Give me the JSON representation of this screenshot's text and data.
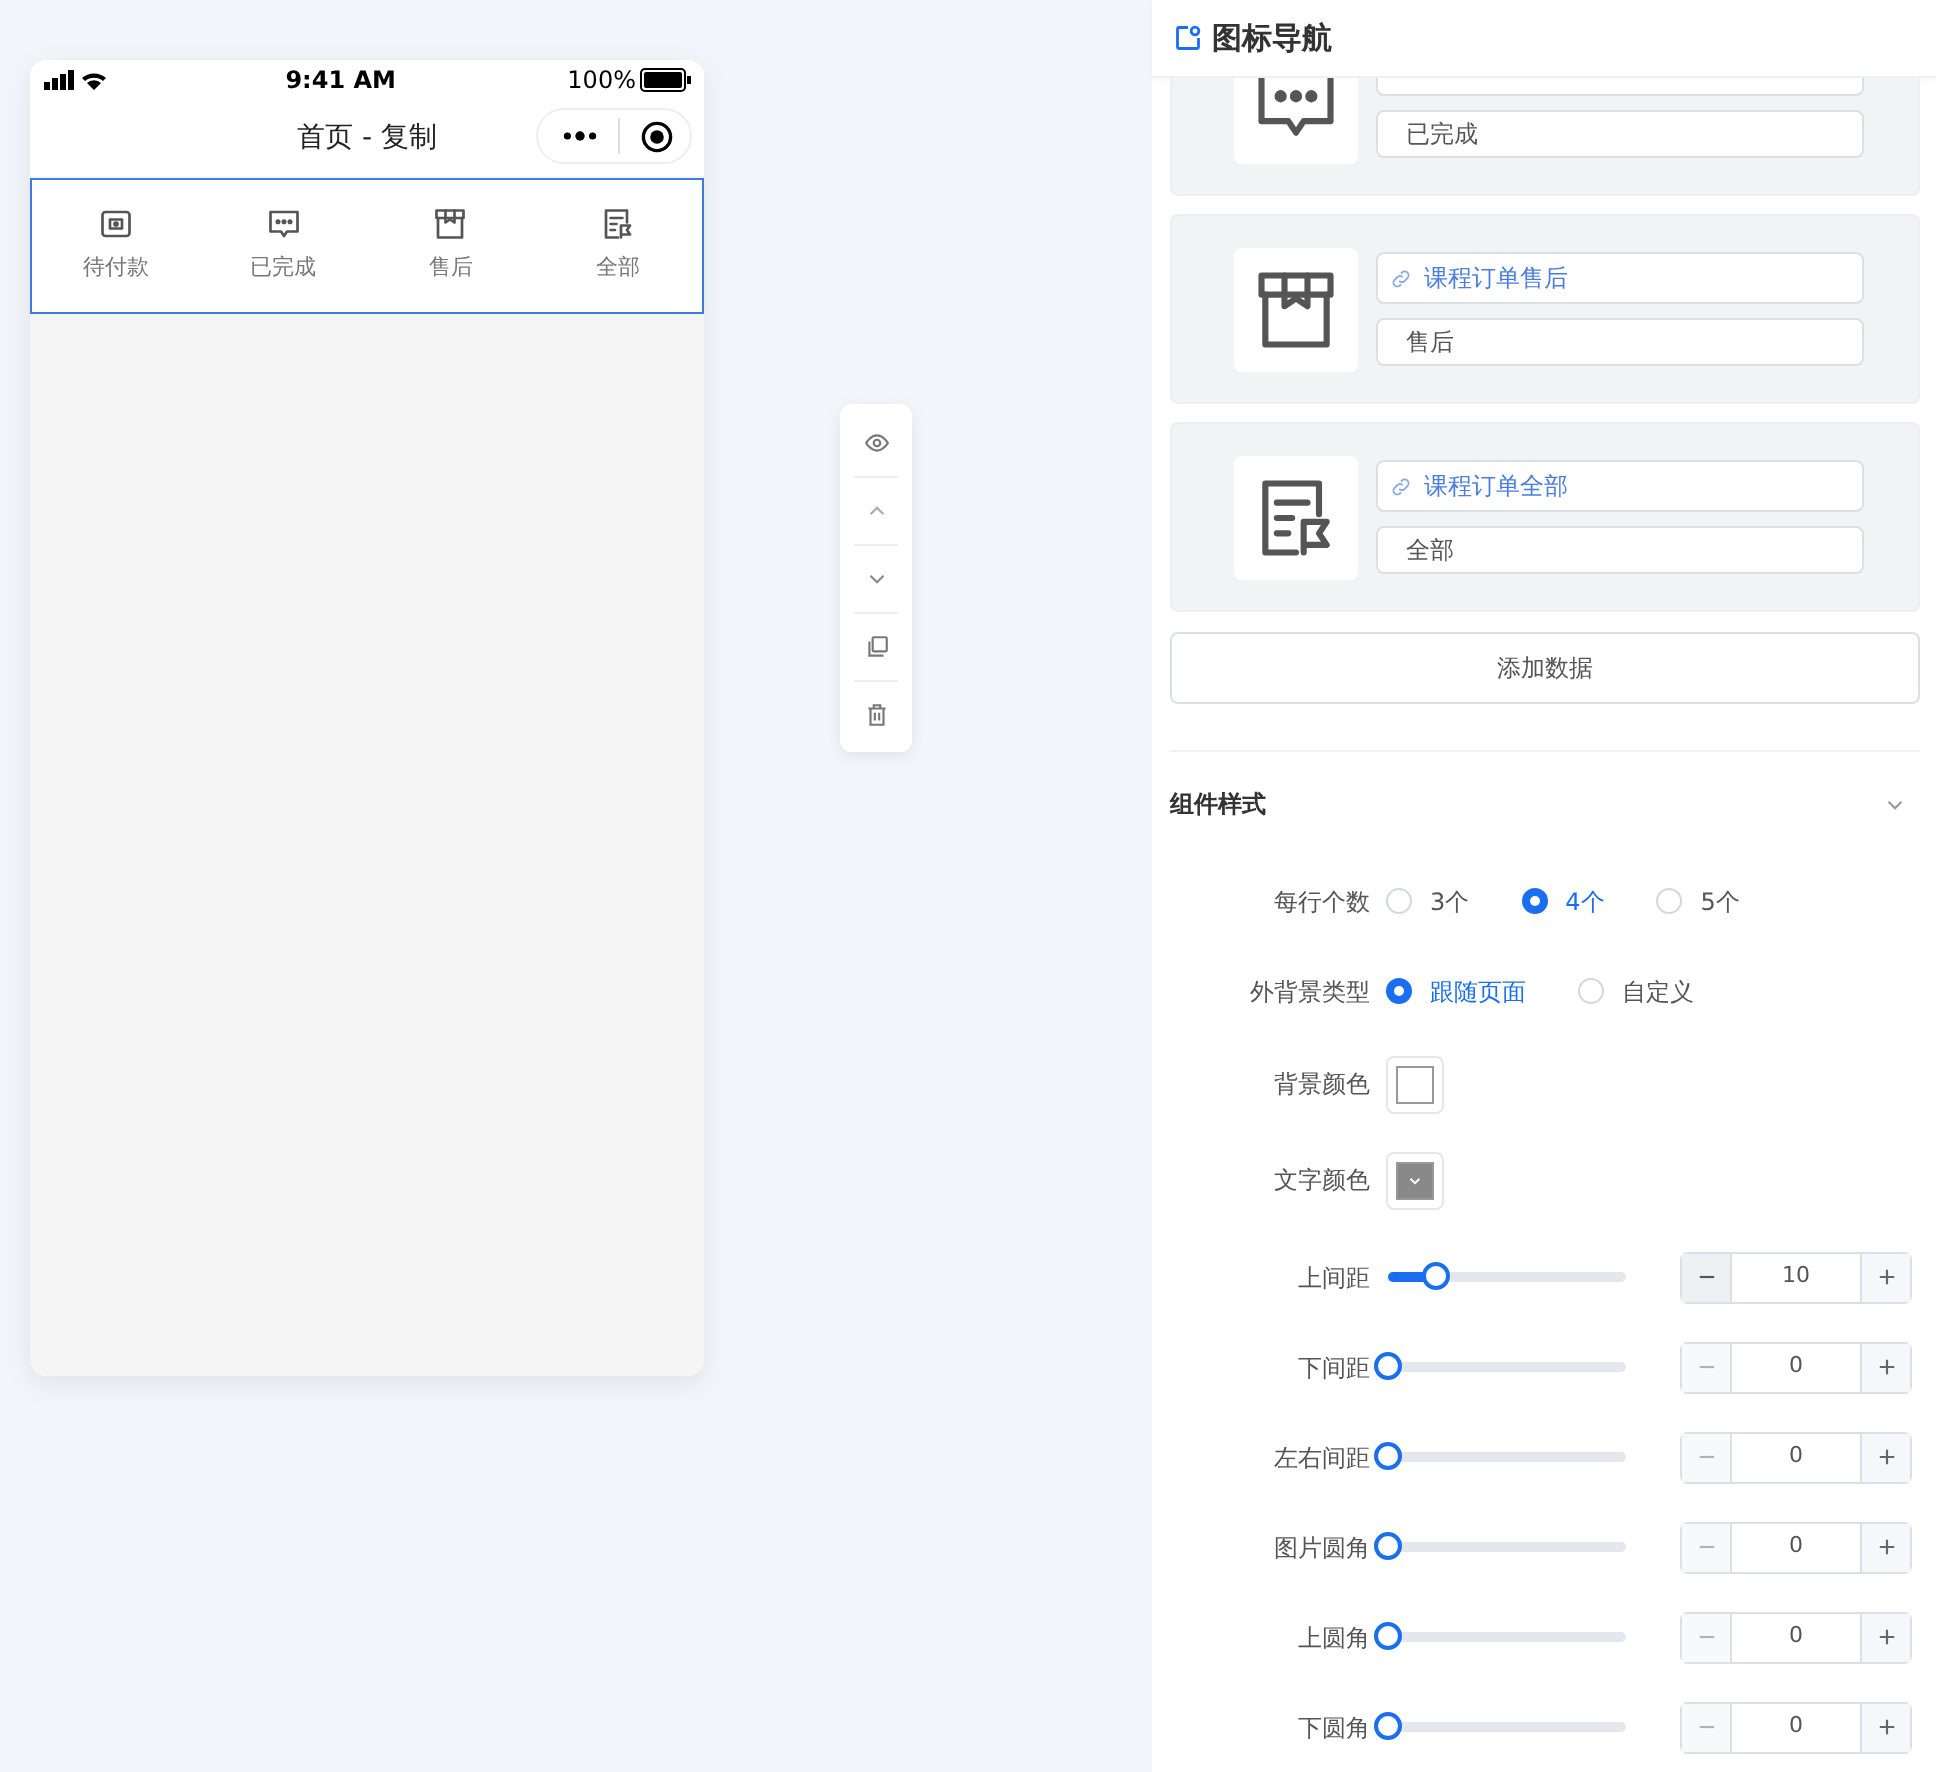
{
  "phone": {
    "status_bar": {
      "time": "9:41 AM",
      "battery": "100%"
    },
    "title": "首页 - 复制",
    "nav_items": [
      {
        "label": "待付款"
      },
      {
        "label": "已完成"
      },
      {
        "label": "售后"
      },
      {
        "label": "全部"
      }
    ]
  },
  "panel": {
    "title": "图标导航",
    "cards": [
      {
        "name": "已完成"
      },
      {
        "link": "课程订单售后",
        "name": "售后"
      },
      {
        "link": "课程订单全部",
        "name": "全部"
      }
    ],
    "add_button": "添加数据",
    "section": {
      "title": "组件样式",
      "expanded": true
    },
    "radio_groups": [
      {
        "label": "每行个数",
        "options": [
          {
            "label": "3个",
            "selected": false
          },
          {
            "label": "4个",
            "selected": true
          },
          {
            "label": "5个",
            "selected": false
          }
        ]
      },
      {
        "label": "外背景类型",
        "options": [
          {
            "label": "跟随页面",
            "selected": true
          },
          {
            "label": "自定义",
            "selected": false
          }
        ]
      }
    ],
    "swatches": [
      {
        "label": "背景颜色",
        "color": "#ffffff",
        "kind": "plain"
      },
      {
        "label": "文字颜色",
        "color": "#888888",
        "kind": "dropdown"
      }
    ],
    "sliders": [
      {
        "label": "上间距",
        "level": 0.2,
        "value": "10",
        "decrease_disabled": false
      },
      {
        "label": "下间距",
        "level": 0,
        "value": "0",
        "decrease_disabled": true
      },
      {
        "label": "左右间距",
        "level": 0,
        "value": "0",
        "decrease_disabled": true
      },
      {
        "label": "图片圆角",
        "level": 0,
        "value": "0",
        "decrease_disabled": true
      },
      {
        "label": "上圆角",
        "level": 0,
        "value": "0",
        "decrease_disabled": true
      },
      {
        "label": "下圆角",
        "level": 0,
        "value": "0",
        "decrease_disabled": true
      }
    ]
  }
}
